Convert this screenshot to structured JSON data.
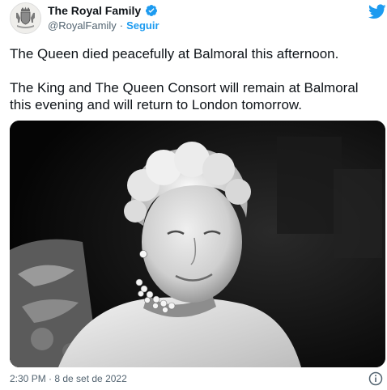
{
  "account": {
    "display_name": "The Royal Family",
    "handle": "@RoyalFamily",
    "separator": "·",
    "follow_label": "Seguir",
    "verified_color": "#1d9bf0"
  },
  "tweet": {
    "text_line1": "The Queen died peacefully at Balmoral this afternoon.",
    "text_line2": "The King and The Queen Consort will remain at Balmoral this evening and will return to London tomorrow.",
    "photo_description": "black-and-white-portrait",
    "timestamp": "2:30 PM · 8 de set de 2022"
  },
  "icons": {
    "brand": "twitter-bird-icon",
    "verified": "verified-badge-icon",
    "info": "info-icon",
    "avatar": "royal-coat-of-arms"
  },
  "colors": {
    "accent": "#1d9bf0",
    "text": "#0f1419",
    "secondary": "#536471"
  }
}
